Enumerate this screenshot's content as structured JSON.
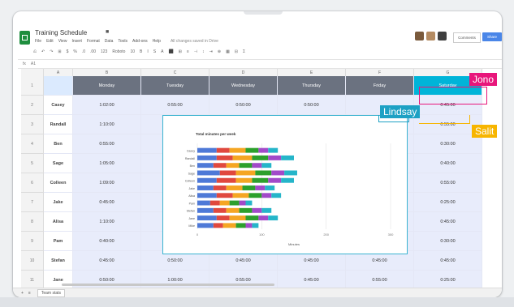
{
  "header": {
    "title": "Training Schedule",
    "menu": [
      "File",
      "Edit",
      "View",
      "Insert",
      "Format",
      "Data",
      "Tools",
      "Add-ons",
      "Help"
    ],
    "save_note": "All changes saved in Drive",
    "comments_label": "Comments",
    "share_label": "Share"
  },
  "toolbar": {
    "items": [
      "⎌",
      "↶",
      "↷",
      "⊞",
      "$",
      "%",
      ".0",
      ".00",
      "123",
      "Roboto",
      "10",
      "B",
      "I",
      "S",
      "A",
      "⬛",
      "⊞",
      "≡",
      "⊣",
      "↕",
      "⇥",
      "⊕",
      "▦",
      "⊟",
      "Σ"
    ]
  },
  "formula": {
    "fx": "fx",
    "ref": "A1"
  },
  "columns": {
    "letters": [
      "A",
      "B",
      "C",
      "D",
      "E",
      "F",
      "G"
    ]
  },
  "days": [
    "Monday",
    "Tuesday",
    "Wednesday",
    "Thursday",
    "Friday",
    "Saturday"
  ],
  "rows": [
    {
      "num": "2",
      "name": "Casey",
      "values": [
        "1:02:00",
        "0:55:00",
        "0:50:00",
        "0:50:00",
        "",
        "0:45:00"
      ]
    },
    {
      "num": "3",
      "name": "Randall",
      "values": [
        "1:10:00",
        "",
        "",
        "",
        "",
        "0:55:00"
      ]
    },
    {
      "num": "4",
      "name": "Ben",
      "values": [
        "0:55:00",
        "",
        "",
        "",
        "",
        "0:30:00"
      ]
    },
    {
      "num": "5",
      "name": "Sage",
      "values": [
        "1:05:00",
        "",
        "",
        "",
        "",
        "0:40:00"
      ]
    },
    {
      "num": "6",
      "name": "Colleen",
      "values": [
        "1:09:00",
        "",
        "",
        "",
        "",
        "0:55:00"
      ]
    },
    {
      "num": "7",
      "name": "Jake",
      "values": [
        "0:45:00",
        "",
        "",
        "",
        "",
        "0:25:00"
      ]
    },
    {
      "num": "8",
      "name": "Alisa",
      "values": [
        "1:10:00",
        "",
        "",
        "",
        "",
        "0:45:00"
      ]
    },
    {
      "num": "9",
      "name": "Pam",
      "values": [
        "0:40:00",
        "",
        "",
        "",
        "",
        "0:30:00"
      ]
    },
    {
      "num": "10",
      "name": "Stefan",
      "values": [
        "0:45:00",
        "0:50:00",
        "0:45:00",
        "0:45:00",
        "0:45:00",
        "0:45:00"
      ]
    },
    {
      "num": "11",
      "name": "Jane",
      "values": [
        "0:50:00",
        "1:00:00",
        "0:55:00",
        "0:45:00",
        "0:55:00",
        "0:25:00"
      ]
    }
  ],
  "header_row_num": "1",
  "sheet_tab": "Team stats",
  "collaborators": {
    "jono": "Jono",
    "lindsay": "Lindsay",
    "salit": "Salit"
  },
  "chart_data": {
    "type": "bar",
    "orientation": "horizontal",
    "stacked": true,
    "title": "Total minutes per week",
    "xlabel": "Minutes",
    "ylabel": "",
    "xlim": [
      0,
      300
    ],
    "x_ticks": [
      "0",
      "100",
      "200",
      "300"
    ],
    "categories": [
      "Casey",
      "Randall",
      "Ben",
      "Sage",
      "Colleen",
      "Jake",
      "Alisa",
      "Pam",
      "Stefan",
      "Jane",
      "Mike"
    ],
    "series": [
      {
        "color": "#4e79d7",
        "values": [
          30,
          30,
          25,
          35,
          30,
          25,
          30,
          20,
          25,
          30,
          25
        ]
      },
      {
        "color": "#e0483e",
        "values": [
          20,
          25,
          20,
          25,
          30,
          20,
          25,
          15,
          20,
          20,
          15
        ]
      },
      {
        "color": "#f5a623",
        "values": [
          25,
          30,
          20,
          30,
          25,
          25,
          25,
          15,
          20,
          25,
          20
        ]
      },
      {
        "color": "#2ca02c",
        "values": [
          20,
          25,
          20,
          25,
          25,
          20,
          20,
          15,
          20,
          20,
          15
        ]
      },
      {
        "color": "#a24ac9",
        "values": [
          15,
          20,
          15,
          20,
          20,
          15,
          15,
          10,
          15,
          15,
          10
        ]
      },
      {
        "color": "#25b5c9",
        "values": [
          15,
          20,
          15,
          20,
          20,
          15,
          15,
          10,
          15,
          15,
          10
        ]
      }
    ]
  },
  "colors": {
    "sheets_green": "#1e8e3e",
    "header_gray": "#6b7280",
    "saturday_blue": "#00b4d8",
    "cell_blue": "#e8ecfb",
    "jono_pink": "#e8167b",
    "lindsay_blue": "#1da1c4",
    "salit_yellow": "#f7b500"
  }
}
